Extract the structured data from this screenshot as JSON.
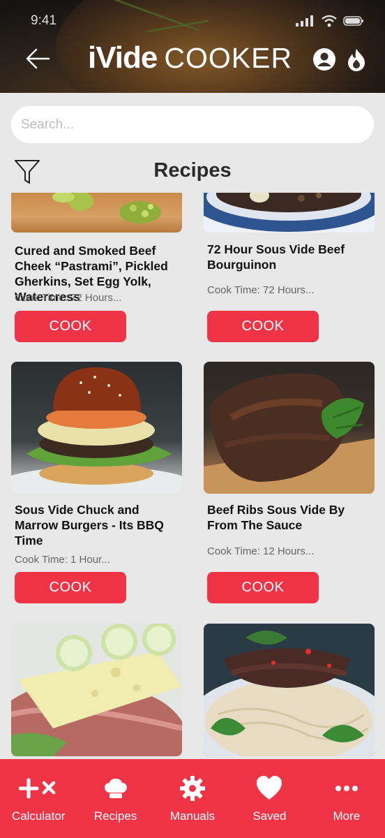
{
  "status_bar": {
    "time": "9:41"
  },
  "header": {
    "logo_bold": "iVide",
    "logo_light": "COOKER",
    "icons": [
      "back-arrow-icon",
      "user-icon",
      "flame-icon"
    ]
  },
  "search": {
    "placeholder": "Search..."
  },
  "page": {
    "title": "Recipes"
  },
  "recipes": [
    {
      "name": "Cured and Smoked Beef Cheek “Pastrami”, Pickled Gherkins, Set Egg Yolk, Watercress",
      "cook_time": "Cook Time: 72 Hours...",
      "button": "COOK"
    },
    {
      "name": "72 Hour Sous Vide Beef Bourguinon",
      "cook_time": "Cook Time: 72 Hours...",
      "button": "COOK"
    },
    {
      "name": "Sous Vide Chuck and Marrow Burgers - Its BBQ Time",
      "cook_time": "Cook Time: 1 Hour...",
      "button": "COOK"
    },
    {
      "name": "Beef Ribs Sous Vide By From The Sauce",
      "cook_time": "Cook Time: 12 Hours...",
      "button": "COOK"
    }
  ],
  "nav": [
    {
      "label": "Calculator",
      "icon": "plus-times-icon"
    },
    {
      "label": "Recipes",
      "icon": "chef-hat-icon"
    },
    {
      "label": "Manuals",
      "icon": "gear-icon"
    },
    {
      "label": "Saved",
      "icon": "heart-icon"
    },
    {
      "label": "More",
      "icon": "more-dots-icon"
    }
  ],
  "colors": {
    "accent": "#f03447",
    "background": "#e8e8e8"
  }
}
